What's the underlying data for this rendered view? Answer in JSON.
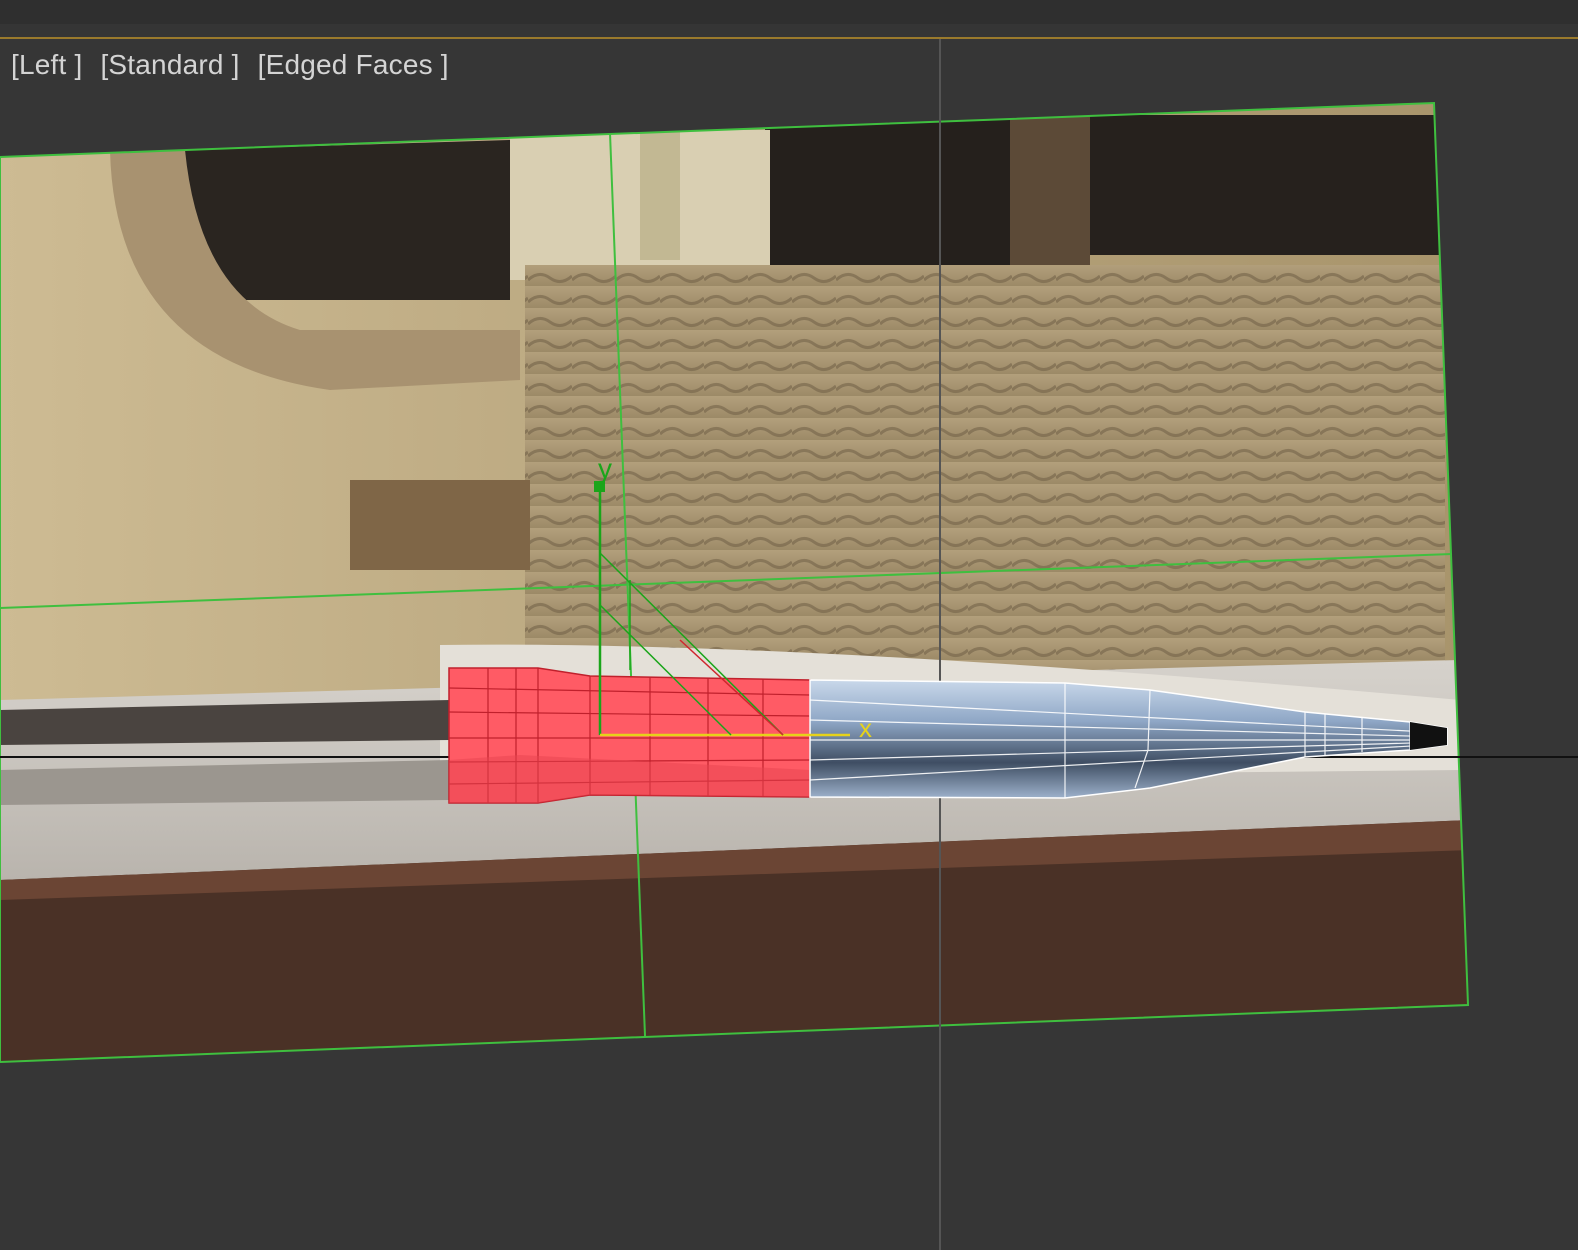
{
  "viewport": {
    "labels": {
      "view": "[Left ]",
      "shading": "[Standard ]",
      "mode": "[Edged Faces ]"
    }
  },
  "gizmo": {
    "y_label": "y",
    "x_label": "x"
  },
  "colors": {
    "background": "#363636",
    "border_active": "#9a7a2c",
    "selection_red": "#ff5b65",
    "mesh_blue": "#8aa3c4",
    "gizmo_y": "#1aa51a",
    "gizmo_x": "#e6d21a",
    "plane_frame": "#3fbf3f"
  }
}
